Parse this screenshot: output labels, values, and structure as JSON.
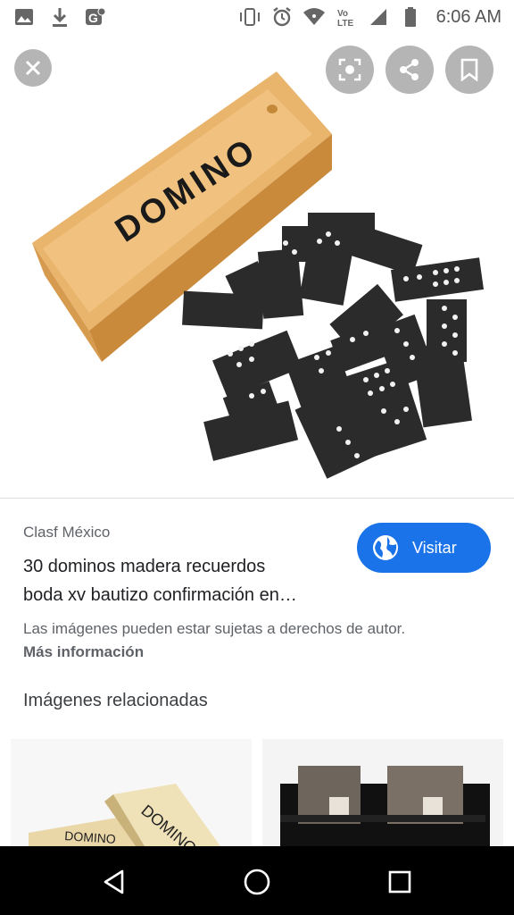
{
  "status_bar": {
    "time": "6:06 AM",
    "left_icons": [
      "image-icon",
      "download-icon",
      "google-settings-icon"
    ],
    "right_icons": [
      "vibrate-icon",
      "alarm-icon",
      "wifi-icon",
      "volte-icon",
      "signal-icon",
      "battery-icon"
    ]
  },
  "image_actions": [
    "close-icon",
    "lens-icon",
    "share-icon",
    "bookmark-icon"
  ],
  "domino_box_text": "DOMINO",
  "result": {
    "source": "Clasf México",
    "title_line1": "30 dominos madera recuerdos",
    "title_line2": "boda xv bautizo confirmación en…",
    "visit_label": "Visitar",
    "rights_text": "Las imágenes pueden estar sujetas a derechos de autor.",
    "more_info": "Más información"
  },
  "related": {
    "heading": "Imágenes relacionadas",
    "thumb1_text": "DOMINO",
    "thumb1b_text": "DOMINO"
  },
  "colors": {
    "accent": "#1a73e8",
    "wood": "#e8b36a",
    "tile": "#2a2a2a"
  },
  "nav": [
    "back-icon",
    "home-icon",
    "recents-icon"
  ]
}
